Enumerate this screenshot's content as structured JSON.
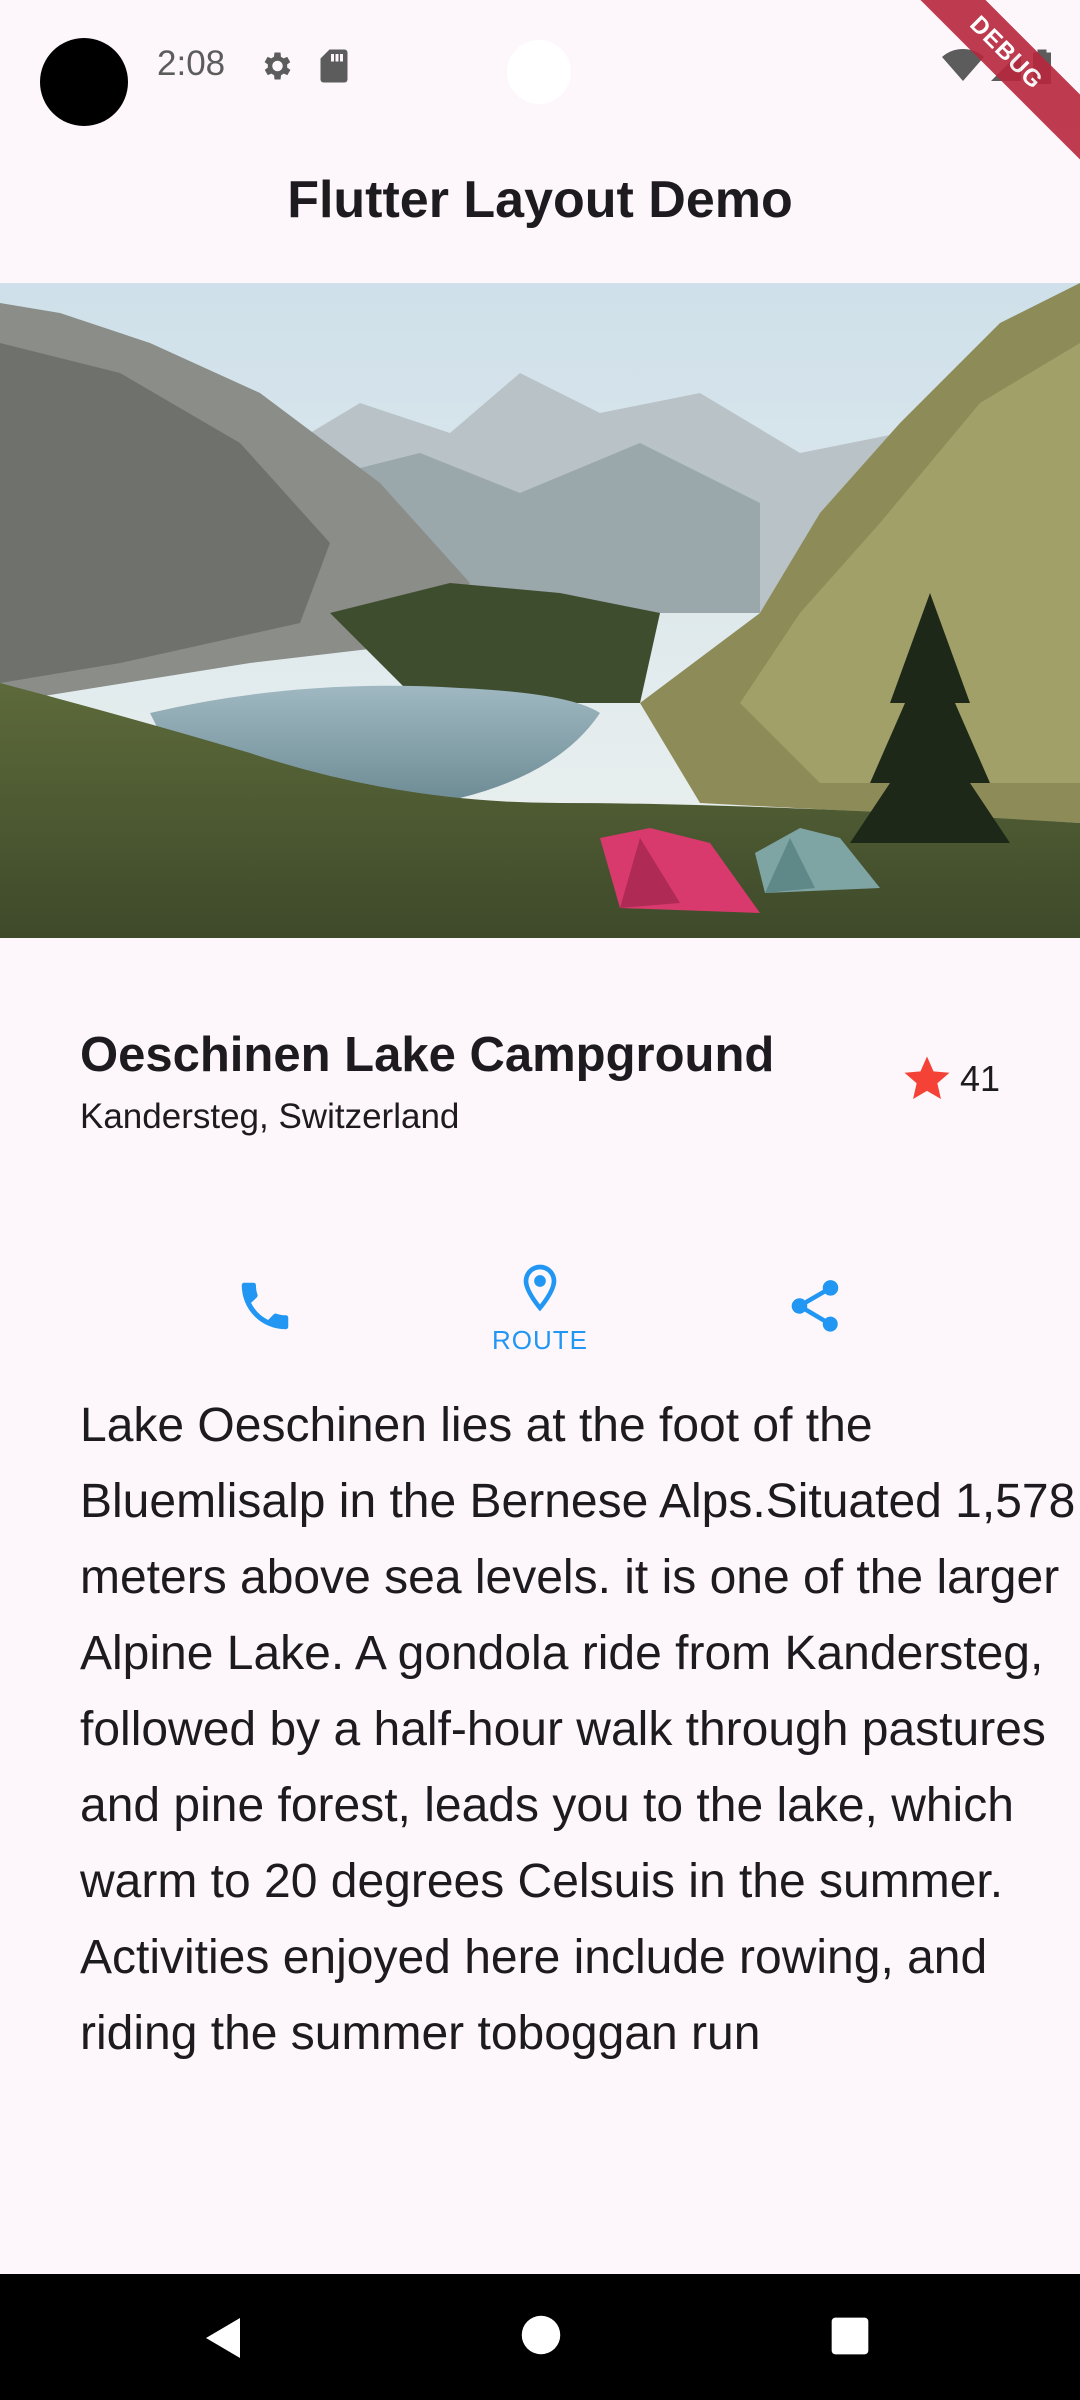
{
  "status_bar": {
    "time": "2:08",
    "icons": [
      "settings-icon",
      "sd-card-icon",
      "wifi-icon",
      "signal-icon",
      "battery-icon"
    ],
    "debug_banner": "DEBUG"
  },
  "app_bar": {
    "title": "Flutter Layout Demo"
  },
  "hero": {
    "image": "lake-campground-photo"
  },
  "place": {
    "name": "Oeschinen Lake Campground",
    "location": "Kandersteg, Switzerland",
    "rating_count": "41",
    "star_color": "#f44336"
  },
  "actions": [
    {
      "icon": "phone-icon",
      "label": ""
    },
    {
      "icon": "location-pin-icon",
      "label": "ROUTE"
    },
    {
      "icon": "share-icon",
      "label": ""
    }
  ],
  "accent_color": "#2196f3",
  "description": "Lake Oeschinen lies at the foot of the Bluemlisalp in the Bernese Alps.Situated 1,578 meters above sea levels. it is one of the larger Alpine Lake. A gondola ride from Kandersteg, followed by a half-hour walk through pastures and pine forest, leads you to the lake, which warm to 20 degrees Celsuis in the summer. Activities enjoyed here include rowing, and riding the summer toboggan run",
  "nav_bar": {
    "buttons": [
      "back-icon",
      "home-icon",
      "recents-icon"
    ]
  }
}
